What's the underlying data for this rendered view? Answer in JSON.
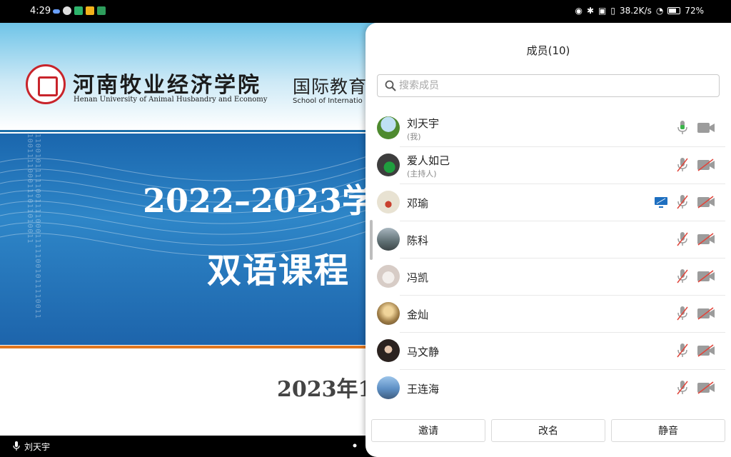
{
  "status_bar": {
    "time": "4:29",
    "network_speed": "38.2K/s",
    "battery": "72%",
    "battery_level": 0.72
  },
  "slide": {
    "university_cn": "河南牧业经济学院",
    "university_en": "Henan University of Animal Husbandry and Economy",
    "school_cn": "国际教育",
    "school_en": "School of Internatio",
    "binary_text": "1100101111100111100011111001011110011 1001111000111011010011",
    "year_title": "2022–2023学",
    "course_title": "双语课程",
    "date_text": "2023年1",
    "colors": {
      "banner": "#1d6fa9",
      "accent_rule": "#e0761f"
    }
  },
  "bottom_bar": {
    "speaker_name": "刘天宇",
    "mic_icon": "mic-icon"
  },
  "members_panel": {
    "title": "成员(10)",
    "search_placeholder": "搜索成员",
    "members": [
      {
        "name": "刘天宇",
        "role": "(我)",
        "mic": "mic-on-icon",
        "camera": "camera-on-icon",
        "avatar_color": "#6aa3c9"
      },
      {
        "name": "爱人如己",
        "role": "(主持人)",
        "mic": "mic-off-icon",
        "camera": "camera-off-icon",
        "avatar_color": "#3f6b4e"
      },
      {
        "name": "邓瑜",
        "role": "",
        "mic": "mic-off-icon",
        "camera": "camera-off-icon",
        "screen_share": "screen-share-icon",
        "avatar_color": "#d8cfbd"
      },
      {
        "name": "陈科",
        "role": "",
        "mic": "mic-off-icon",
        "camera": "camera-off-icon",
        "avatar_color": "#7f8c8d"
      },
      {
        "name": "冯凯",
        "role": "",
        "mic": "mic-off-icon",
        "camera": "camera-off-icon",
        "avatar_color": "#e2dad6"
      },
      {
        "name": "金灿",
        "role": "",
        "mic": "mic-off-icon",
        "camera": "camera-off-icon",
        "avatar_color": "#b08a4e"
      },
      {
        "name": "马文静",
        "role": "",
        "mic": "mic-off-icon",
        "camera": "camera-off-icon",
        "avatar_color": "#3b2f2a"
      },
      {
        "name": "王连海",
        "role": "",
        "mic": "mic-off-icon",
        "camera": "camera-off-icon",
        "avatar_color": "#5d8fc4"
      }
    ],
    "actions": {
      "invite": "邀请",
      "rename": "改名",
      "mute": "静音"
    },
    "colors": {
      "mic_on": "#3bb54a",
      "mic_off_slash": "#e0463c",
      "screen_share": "#1e6fc0"
    }
  }
}
